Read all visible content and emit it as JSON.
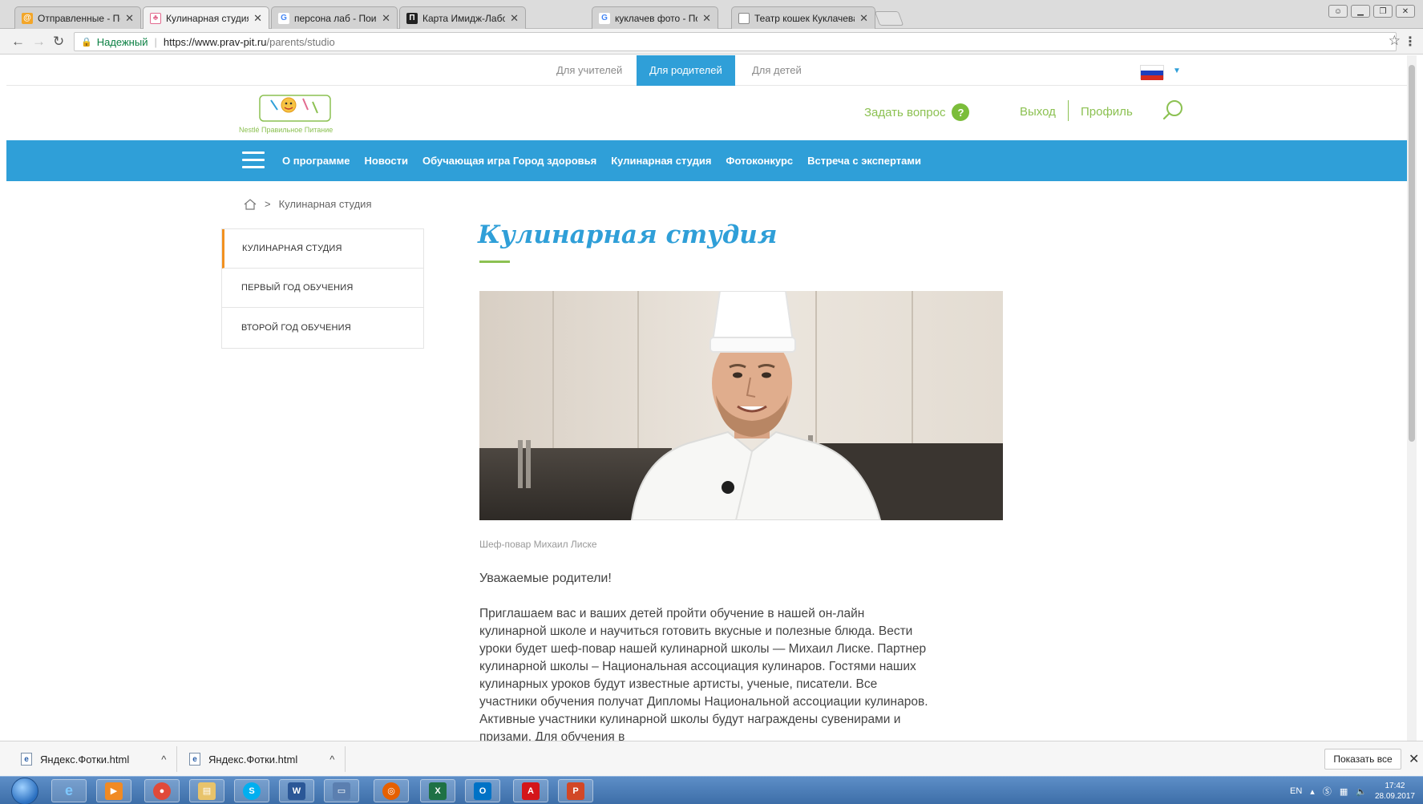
{
  "browser": {
    "tabs": [
      {
        "title": "Отправленные - Почта",
        "favicon": "mail-icon",
        "color": "#f3a629"
      },
      {
        "title": "Кулинарная студия",
        "favicon": "site-icon",
        "color": "#e26b8f"
      },
      {
        "title": "персона лаб - Поиск в",
        "favicon": "google-icon",
        "color": "#4285f4"
      },
      {
        "title": "Карта Имидж-Лаборат",
        "favicon": "map-icon",
        "color": "#222222"
      },
      {
        "title": "куклачев фото - Поиск",
        "favicon": "google-icon",
        "color": "#4285f4"
      },
      {
        "title": "Театр кошек Куклачева",
        "favicon": "page-icon",
        "color": "#888888"
      }
    ],
    "active_tab": 1,
    "close_glyph": "✕",
    "secure_label": "Надежный",
    "url_host": "https://www.prav-pit.ru",
    "url_path": "/parents/studio"
  },
  "site": {
    "audience": [
      {
        "label": "Для учителей"
      },
      {
        "label": "Для родителей"
      },
      {
        "label": "Для детей"
      }
    ],
    "active_audience": 1,
    "logo_text": "Nestlé Правильное Питание",
    "ask_label": "Задать вопрос",
    "ask_badge": "?",
    "logout_label": "Выход",
    "profile_label": "Профиль",
    "nav": [
      "О программе",
      "Новости",
      "Обучающая игра Город здоровья",
      "Кулинарная студия",
      "Фотоконкурс",
      "Встреча с экспертами"
    ],
    "breadcrumb": {
      "separator": ">",
      "current": "Кулинарная студия"
    },
    "sidemenu": [
      "Кулинарная студия",
      "Первый год обучения",
      "Второй год обучения"
    ],
    "page_title": "Кулинарная студия",
    "photo_caption": "Шеф-повар Михаил Лиске",
    "greeting": "Уважаемые родители!",
    "body_text": "Приглашаем вас и ваших детей пройти обучение в нашей он-лайн кулинарной школе и научиться готовить вкусные и полезные блюда. Вести уроки будет шеф-повар нашей кулинарной школы — Михаил Лиске. Партнер кулинарной школы – Национальная ассоциация кулинаров. Гостями наших кулинарных уроков будут известные артисты, ученые, писатели. Все участники обучения получат Дипломы Национальной ассоциации кулинаров. Активные участники кулинарной школы будут награждены сувенирами и призами. Для обучения в",
    "colors": {
      "brand_blue": "#2f9fd8",
      "brand_green": "#8cc152",
      "accent_orange": "#f29120"
    }
  },
  "downloads": {
    "items": [
      {
        "name": "Яндекс.Фотки.html"
      },
      {
        "name": "Яндекс.Фотки.html"
      }
    ],
    "show_all_label": "Показать все"
  },
  "taskbar": {
    "lang": "EN",
    "time": "17:42",
    "date": "28.09.2017"
  }
}
